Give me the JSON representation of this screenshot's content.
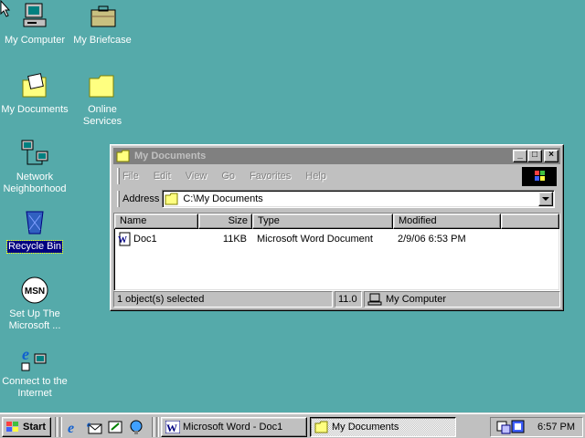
{
  "desktop": {
    "icons": [
      {
        "label": "My Computer"
      },
      {
        "label": "My Briefcase"
      },
      {
        "label": "My Documents"
      },
      {
        "label": "Online Services"
      },
      {
        "label": "Network Neighborhood"
      },
      {
        "label": "Recycle Bin"
      },
      {
        "label": "Set Up The Microsoft ..."
      },
      {
        "label": "Connect to the Internet"
      }
    ]
  },
  "window": {
    "title": "My Documents",
    "menu": [
      "File",
      "Edit",
      "View",
      "Go",
      "Favorites",
      "Help"
    ],
    "address_label": "Address",
    "address_value": "C:\\My Documents",
    "columns": [
      "Name",
      "Size",
      "Type",
      "Modified"
    ],
    "files": [
      {
        "name": "Doc1",
        "size": "11KB",
        "type": "Microsoft Word Document",
        "modified": "2/9/06 6:53 PM"
      }
    ],
    "status": {
      "selected": "1 object(s) selected",
      "size": "11.0",
      "location": "My Computer"
    }
  },
  "taskbar": {
    "start_label": "Start",
    "tasks": [
      {
        "label": "Microsoft Word - Doc1",
        "active": false
      },
      {
        "label": "My Documents",
        "active": true
      }
    ],
    "clock": "6:57 PM"
  }
}
